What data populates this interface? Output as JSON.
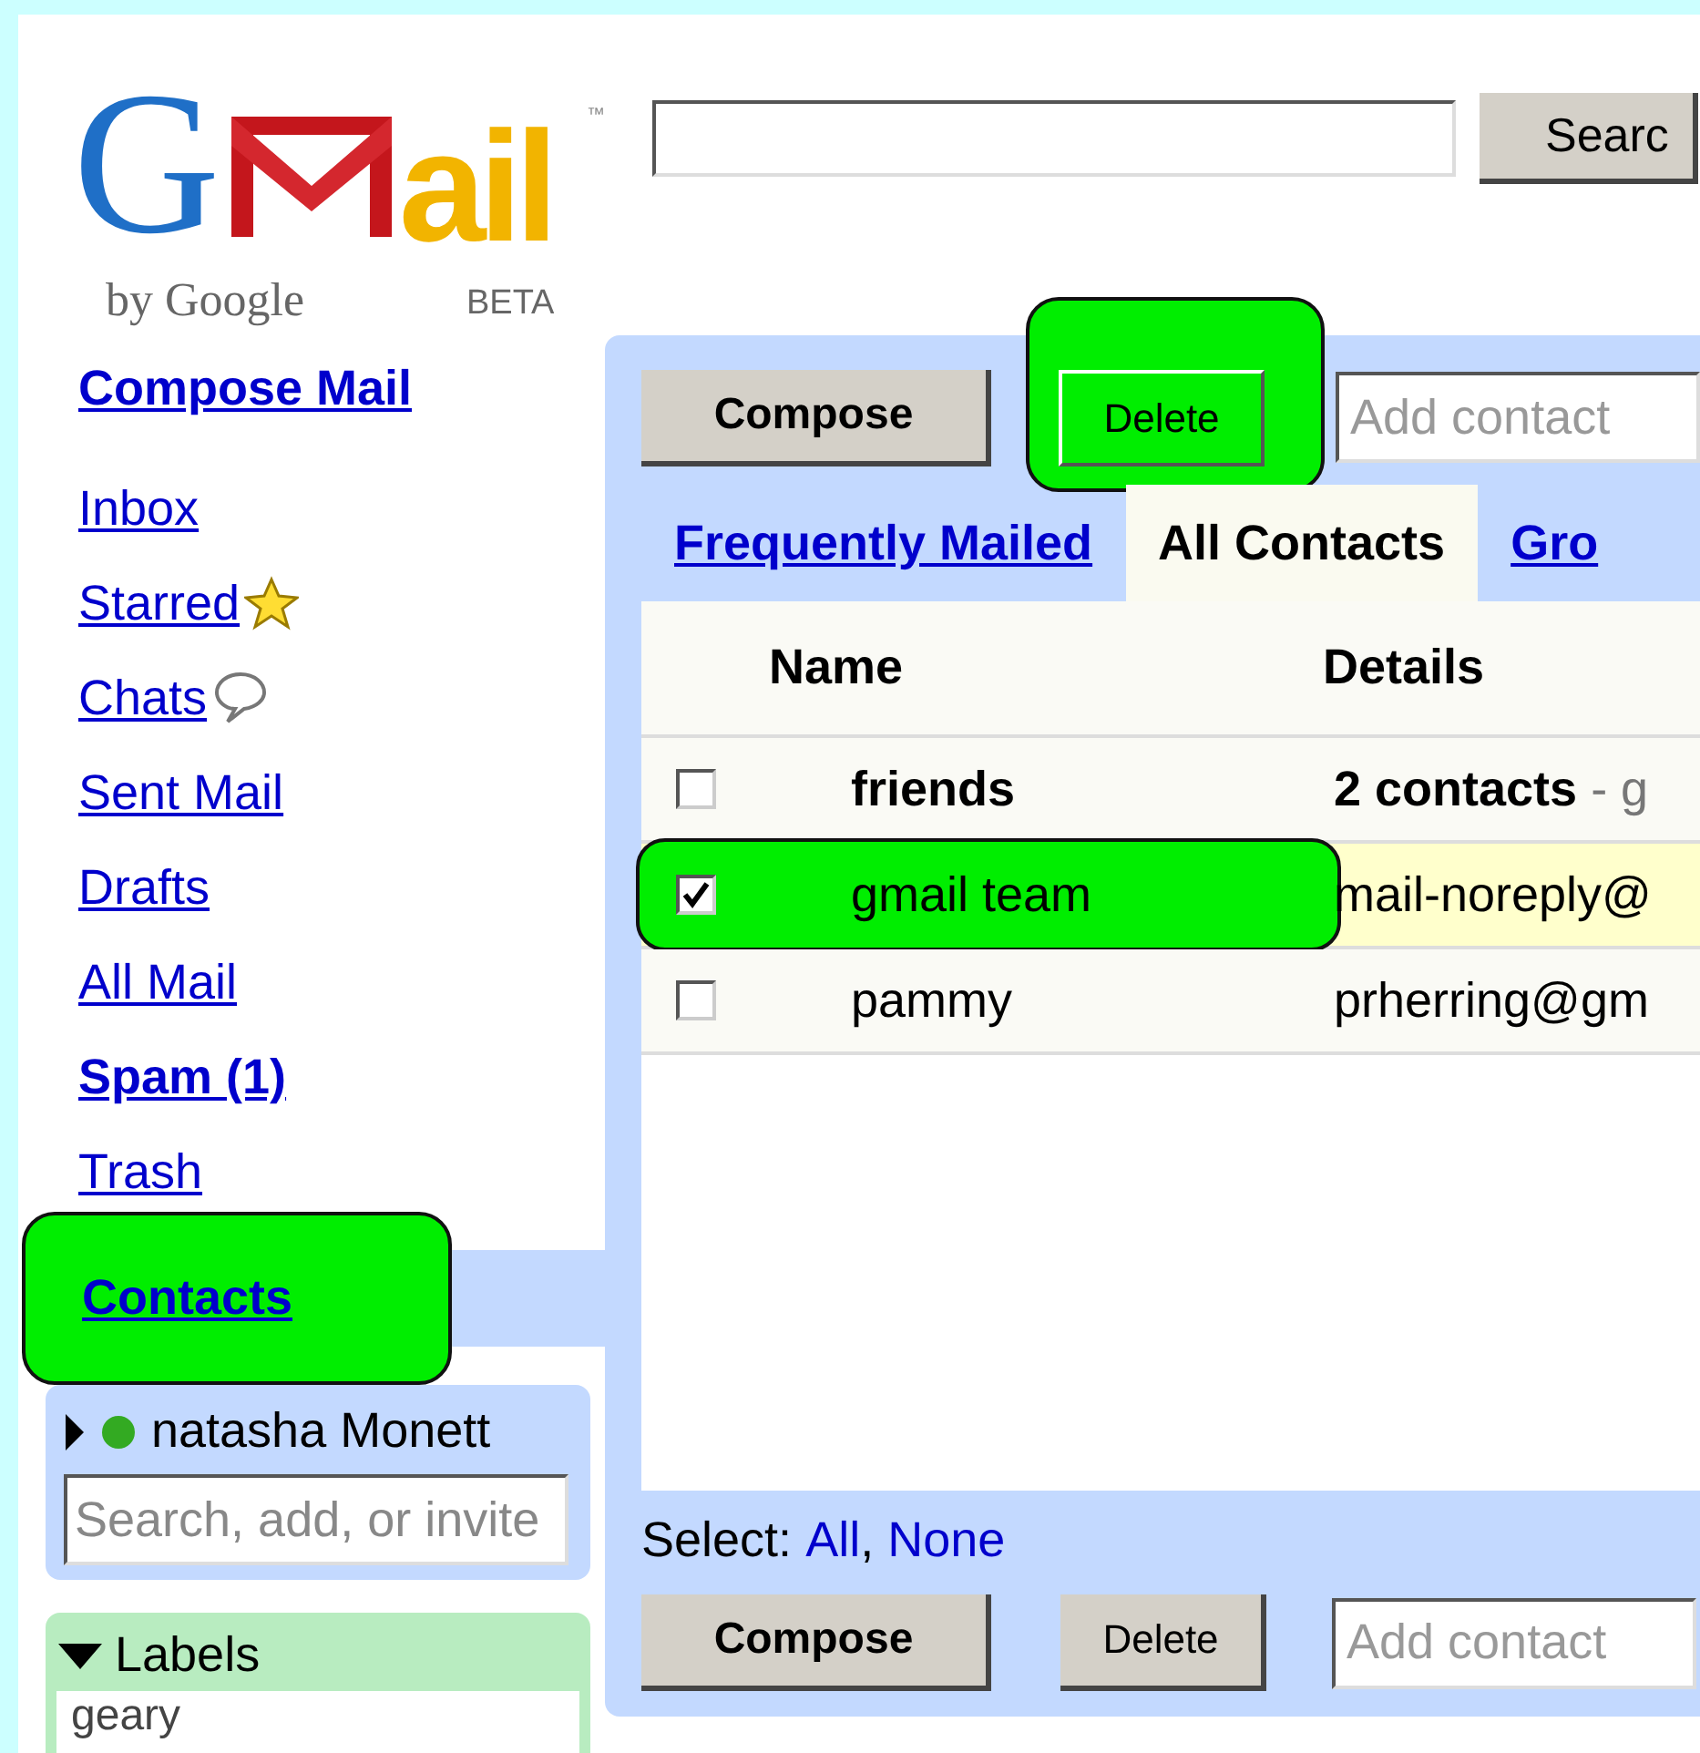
{
  "logo": {
    "first": "G",
    "rest": "ail",
    "trademark": "™",
    "byline": "by Google",
    "badge": "BETA"
  },
  "search": {
    "button": "Searc"
  },
  "compose_link": "Compose Mail",
  "nav": [
    {
      "label": "Inbox",
      "kind": "plain"
    },
    {
      "label": "Starred",
      "kind": "star"
    },
    {
      "label": "Chats",
      "kind": "chat"
    },
    {
      "label": "Sent Mail",
      "kind": "plain"
    },
    {
      "label": "Drafts",
      "kind": "plain"
    },
    {
      "label": "All Mail",
      "kind": "plain"
    },
    {
      "label": "Spam (1)",
      "kind": "bold"
    },
    {
      "label": "Trash",
      "kind": "plain"
    }
  ],
  "contacts_link": {
    "label": "Contacts",
    "highlighted": true
  },
  "chat": {
    "user": "natasha Monett",
    "online": true,
    "placeholder": "Search, add, or invite"
  },
  "labels": {
    "title": "Labels",
    "expanded": true,
    "items": [
      "geary"
    ]
  },
  "toolbar": {
    "compose": "Compose",
    "delete": "Delete",
    "delete_highlighted": true,
    "add_placeholder": "Add contact"
  },
  "tabs": [
    {
      "label": "Frequently Mailed",
      "selected": false
    },
    {
      "label": "All Contacts",
      "selected": true
    },
    {
      "label": "Gro",
      "selected": false
    }
  ],
  "table": {
    "columns": [
      "Name",
      "Details"
    ],
    "rows": [
      {
        "kind": "group",
        "name": "friends",
        "details": "2 contacts",
        "details_extra": " - g",
        "checked": false,
        "selected": false
      },
      {
        "kind": "contact",
        "name": "gmail team",
        "details": "mail-noreply@",
        "checked": true,
        "selected": true
      },
      {
        "kind": "contact",
        "name": "pammy",
        "details": "prherring@gm",
        "checked": false,
        "selected": false
      }
    ]
  },
  "select": {
    "label": "Select:",
    "all": "All",
    "separator": ",",
    "none": "None"
  },
  "bottom_toolbar": {
    "compose": "Compose",
    "delete": "Delete",
    "add_placeholder": "Add contact"
  }
}
